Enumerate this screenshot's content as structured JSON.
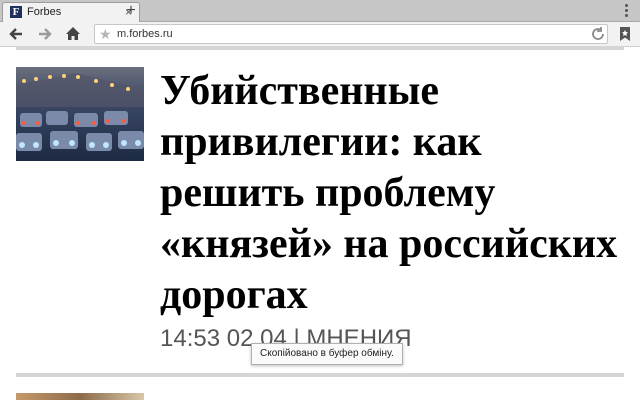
{
  "browser": {
    "tab": {
      "title": "Forbes",
      "favicon_letter": "F",
      "close_glyph": "×"
    },
    "new_tab_glyph": "+",
    "address_bar": {
      "url": "m.forbes.ru"
    },
    "icons": [
      "back-icon",
      "forward-icon",
      "home-icon",
      "star-icon",
      "reload-icon",
      "bookmarks-icon",
      "overflow-menu-icon"
    ]
  },
  "article": {
    "headline": "Убийственные привилегии: как решить проблему «князей» на российских дорогах",
    "meta": "14:53 02.04 | МНЕНИЯ"
  },
  "toast": {
    "text": "Скопійовано в буфер обміну."
  },
  "colors": {
    "tabstrip": "#c6c6c6",
    "toolbar": "#f2f2f2",
    "favicon": "#20305e",
    "divider": "#d5d5d5"
  }
}
